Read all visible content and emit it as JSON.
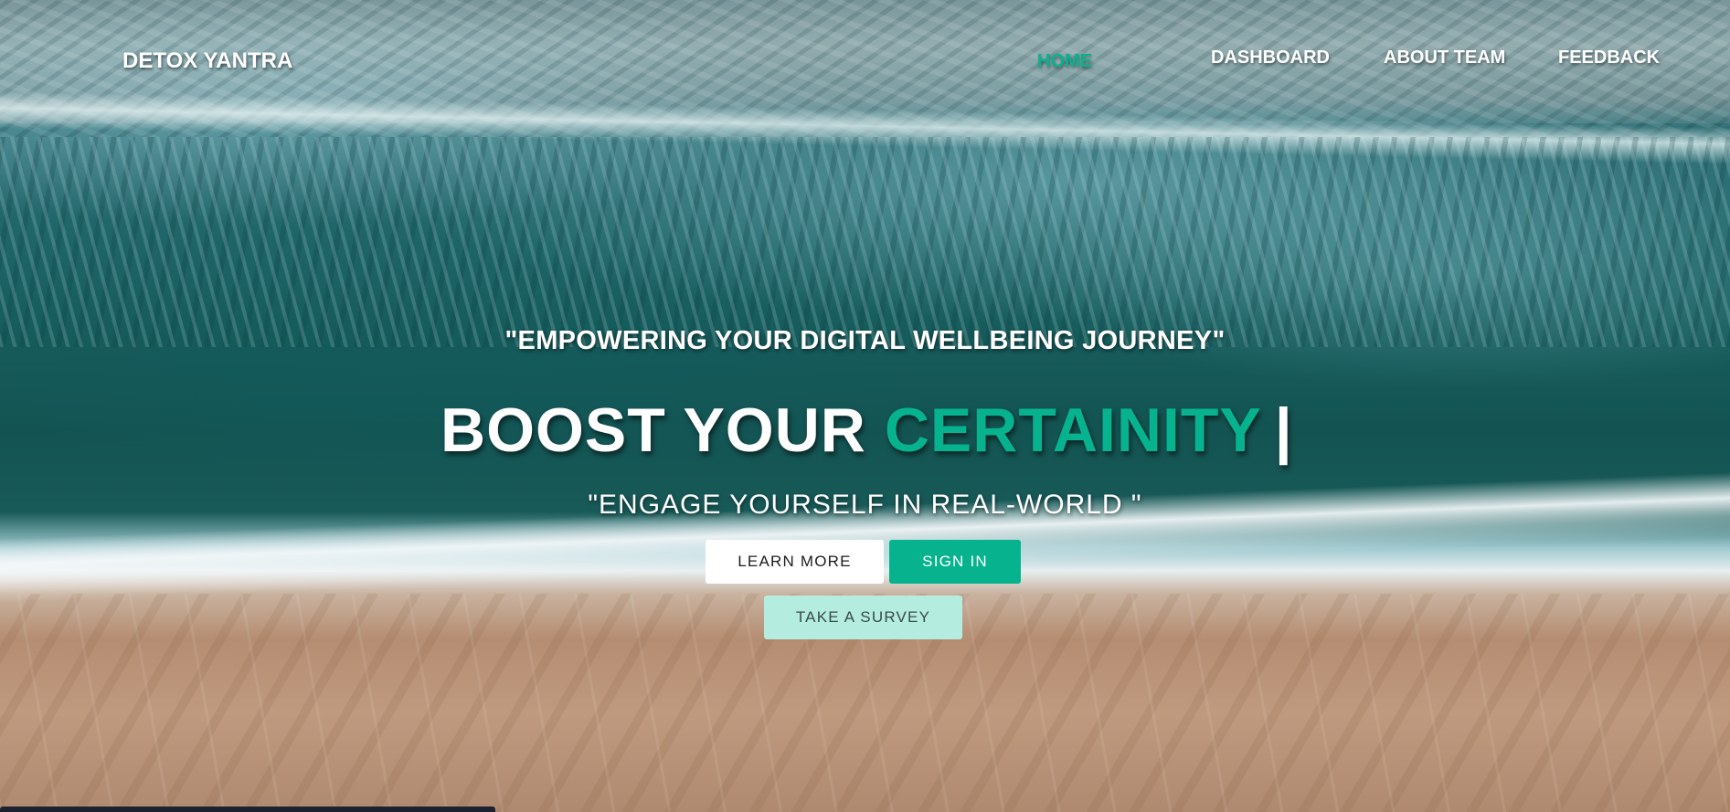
{
  "nav": {
    "brand": "DETOX YANTRA",
    "links": [
      {
        "label": "HOME",
        "active": true
      },
      {
        "label": "DASHBOARD",
        "active": false
      },
      {
        "label": "ABOUT TEAM",
        "active": false
      },
      {
        "label": "FEEDBACK",
        "active": false
      }
    ]
  },
  "hero": {
    "tagline": "\"EMPOWERING YOUR DIGITAL WELLBEING JOURNEY\"",
    "headline_prefix": "BOOST YOUR",
    "headline_accent": "CERTAINITY",
    "headline_cursor": "|",
    "subline": "\"ENGAGE YOURSELF IN REAL-WORLD \"",
    "buttons": {
      "learn_more": "LEARN MORE",
      "sign_in": "SIGN IN",
      "take_survey": "TAKE A SURVEY"
    }
  },
  "colors": {
    "accent": "#07b38f",
    "survey_button": "#b4ece0",
    "text": "#ffffff"
  }
}
